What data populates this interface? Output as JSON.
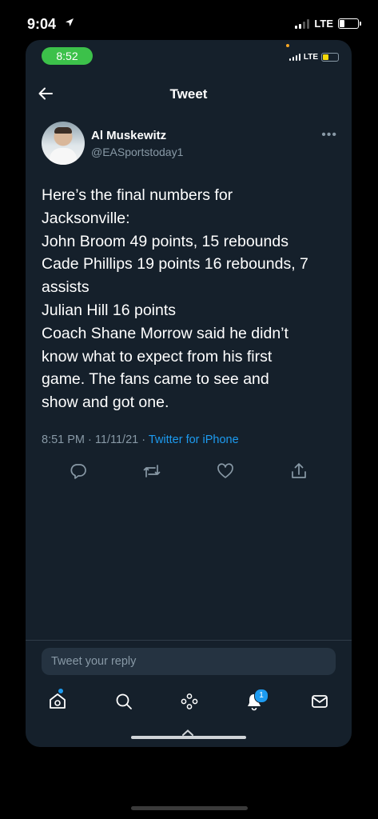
{
  "device": {
    "time": "9:04",
    "network": "LTE"
  },
  "app_status": {
    "time": "8:52",
    "network": "LTE"
  },
  "nav": {
    "title": "Tweet"
  },
  "tweet": {
    "author_name": "Al Muskewitz",
    "author_handle": "@EASportstoday1",
    "lines": [
      "Here’s the final numbers for",
      "Jacksonville:",
      "John Broom 49 points, 15 rebounds",
      "Cade Phillips 19 points 16 rebounds, 7",
      "assists",
      "Julian Hill 16 points",
      "Coach Shane Morrow said he didn’t",
      "know what to expect from his first",
      "game. The fans came to see and",
      "show and got one."
    ],
    "time": "8:51 PM",
    "date": "11/11/21",
    "separator": "·",
    "client": "Twitter for iPhone"
  },
  "reply": {
    "placeholder": "Tweet your reply"
  },
  "tabbar": {
    "notifications_count": "1"
  },
  "colors": {
    "background": "#15202b",
    "accent": "#1d9bf0",
    "secondary_text": "#8899a6",
    "app_time_pill": "#3cc14a"
  }
}
